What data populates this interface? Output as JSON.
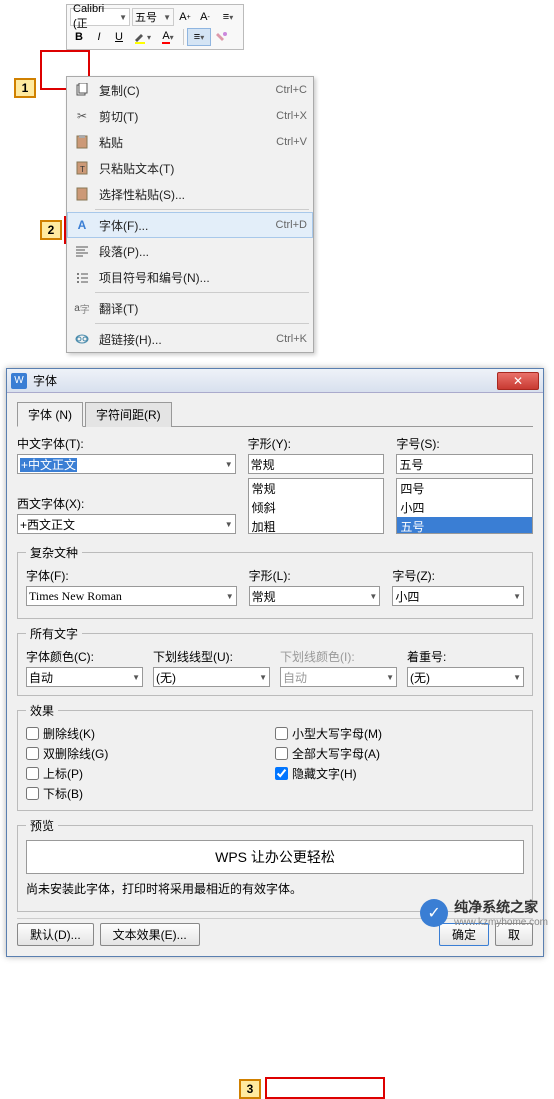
{
  "toolbar": {
    "font_name": "Calibri (正",
    "font_size": "五号",
    "bold": "B",
    "italic": "I",
    "underline": "U"
  },
  "annotations": {
    "a1": "1",
    "a2": "2",
    "a3": "3"
  },
  "ctx": {
    "copy": "复制(C)",
    "copy_sc": "Ctrl+C",
    "cut": "剪切(T)",
    "cut_sc": "Ctrl+X",
    "paste": "粘贴",
    "paste_sc": "Ctrl+V",
    "paste_text": "只粘贴文本(T)",
    "paste_special": "选择性粘贴(S)...",
    "font": "字体(F)...",
    "font_sc": "Ctrl+D",
    "paragraph": "段落(P)...",
    "bullets": "项目符号和编号(N)...",
    "translate": "翻译(T)",
    "hyperlink": "超链接(H)...",
    "hyperlink_sc": "Ctrl+K"
  },
  "dialog": {
    "title": "字体",
    "tab_font": "字体 (N)",
    "tab_spacing": "字符间距(R)",
    "cn_font_label": "中文字体(T):",
    "cn_font_value": "+中文正文",
    "west_font_label": "西文字体(X):",
    "west_font_value": "+西文正文",
    "style_label": "字形(Y):",
    "style_value": "常规",
    "style_opts": [
      "常规",
      "倾斜",
      "加粗"
    ],
    "size_label": "字号(S):",
    "size_value": "五号",
    "size_opts": [
      "四号",
      "小四",
      "五号"
    ],
    "complex_legend": "复杂文种",
    "complex_font_label": "字体(F):",
    "complex_font_value": "Times New Roman",
    "complex_style_label": "字形(L):",
    "complex_style_value": "常规",
    "complex_size_label": "字号(Z):",
    "complex_size_value": "小四",
    "all_text_legend": "所有文字",
    "font_color_label": "字体颜色(C):",
    "font_color_value": "自动",
    "underline_label": "下划线线型(U):",
    "underline_value": "(无)",
    "underline_color_label": "下划线颜色(I):",
    "underline_color_value": "自动",
    "emphasis_label": "着重号:",
    "emphasis_value": "(无)",
    "effects_legend": "效果",
    "strike": "删除线(K)",
    "dstrike": "双删除线(G)",
    "superscript": "上标(P)",
    "subscript": "下标(B)",
    "smallcaps": "小型大写字母(M)",
    "allcaps": "全部大写字母(A)",
    "hidden": "隐藏文字(H)",
    "preview_legend": "预览",
    "preview_text": "WPS 让办公更轻松",
    "note": "尚未安装此字体，打印时将采用最相近的有效字体。",
    "btn_default": "默认(D)...",
    "btn_texteffect": "文本效果(E)...",
    "btn_ok": "确定",
    "btn_cancel": "取"
  },
  "watermark": {
    "name": "纯净系统之家",
    "url": "www.kzmyhome.com"
  }
}
